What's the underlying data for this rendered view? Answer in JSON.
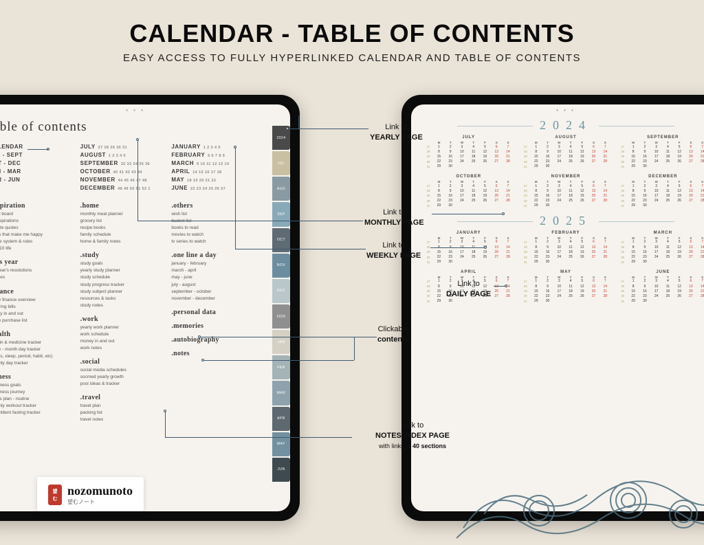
{
  "header": {
    "title": "CALENDAR - TABLE OF CONTENTS",
    "subtitle": "EASY ACCESS TO FULLY HYPERLINKED CALENDAR AND TABLE OF CONTENTS"
  },
  "toc": {
    "title": "table of contents",
    "topcols": [
      {
        "items": [
          "CALENDAR",
          "JUL - SEPT",
          "OCT - DEC",
          "JAN - MAR",
          "APR - JUN"
        ]
      },
      {
        "items": [
          "JULY",
          "AUGUST",
          "SEPTEMBER",
          "OCTOBER",
          "NOVEMBER",
          "DECEMBER"
        ],
        "nums": [
          "27 28 29 30 31",
          "1 2 3 4 5",
          "32 33 34 35 36",
          "40 41 42 43 44",
          "44 45 46 47 48",
          "48 49 50 51 52 1"
        ]
      },
      {
        "items": [
          "JANUARY",
          "FEBRUARY",
          "MARCH",
          "APRIL",
          "MAY",
          "JUNE"
        ],
        "nums": [
          "1 2 3 4 5",
          "5 6 7 8 9",
          "9 10 11 12 13 14",
          "14 15 16 17 18",
          "18 19 20 21 22",
          "22 23 24 25 26 27"
        ]
      }
    ],
    "sections": [
      {
        "head": ".inspiration",
        "items": [
          "visual board",
          "life inspirations",
          "favorite quotes",
          "things that make me happy",
          "my life system & rules",
          "level 10 life"
        ]
      },
      {
        "head": ".this year",
        "items": [
          "this year's resolutions",
          "routines"
        ]
      },
      {
        "head": ".finance",
        "items": [
          "yearly finance overview",
          "recurring bills",
          "money in and out",
          "online purchase list"
        ]
      },
      {
        "head": ".health",
        "items": [
          "vitamin & medicine tracker",
          "yearly - month day tracker",
          "(drinks, sleep, period, habit, etc)",
          "monthly day tracker"
        ]
      },
      {
        "head": ".fitness",
        "items": [
          "my fitness goals",
          "my fitness journey",
          "fitness plan - routine",
          "monthly workout tracker",
          "intermittent fasting tracker"
        ]
      }
    ],
    "sections2": [
      {
        "head": ".home",
        "items": [
          "monthly meal planner",
          "grocery list",
          "recipe books",
          "family schedule",
          "home & family notes"
        ]
      },
      {
        "head": ".study",
        "items": [
          "study goals",
          "yearly study planner",
          "study schedule",
          "study progress tracker",
          "study subject planner",
          "resources & tasks",
          "study notes"
        ]
      },
      {
        "head": ".work",
        "items": [
          "yearly work planner",
          "work schedule",
          "money in and out",
          "work notes"
        ]
      },
      {
        "head": ".social",
        "items": [
          "social media schedules",
          "socmed yearly growth",
          "post ideas & tracker"
        ]
      },
      {
        "head": ".travel",
        "items": [
          "travel plan",
          "packing list",
          "travel notes"
        ]
      }
    ],
    "sections3": [
      {
        "head": ".others",
        "items": [
          "wish list",
          "bucket list",
          "books to read",
          "movies to watch",
          "tv series to watch"
        ]
      },
      {
        "head": ".one line a day",
        "items": [
          "january - february",
          "march - april",
          "may - june",
          "july - august",
          "september - october",
          "november - december"
        ]
      },
      {
        "head": ".personal data",
        "items": []
      },
      {
        "head": ".memories",
        "items": []
      },
      {
        "head": ".autobiography",
        "items": []
      },
      {
        "head": ".notes",
        "items": []
      }
    ],
    "tabs": [
      {
        "label": "2024",
        "color": "#4a4a4a"
      },
      {
        "label": "JUL",
        "color": "#c9bfa3"
      },
      {
        "label": "AUG",
        "color": "#8a9aa3"
      },
      {
        "label": "SEP",
        "color": "#88a9b8"
      },
      {
        "label": "OCT",
        "color": "#5f6b74"
      },
      {
        "label": "NOV",
        "color": "#6c8da0"
      },
      {
        "label": "DEC",
        "color": "#b9c6ca"
      },
      {
        "label": "2025",
        "color": "#8f8f8f"
      },
      {
        "label": "JAN",
        "color": "#d5d0c4"
      },
      {
        "label": "FEB",
        "color": "#a3b3b6"
      },
      {
        "label": "MAR",
        "color": "#8ea2ad"
      },
      {
        "label": "APR",
        "color": "#5d6870"
      },
      {
        "label": "MAY",
        "color": "#7290a0"
      },
      {
        "label": "JUN",
        "color": "#3e4a4f"
      }
    ]
  },
  "callouts": {
    "yearly": {
      "line1": "Link to",
      "line2": "YEARLY PAGE"
    },
    "monthly": {
      "line1": "Link to",
      "line2": "MONTHLY PAGE"
    },
    "weekly": {
      "line1": "Link to",
      "line2": "WEEKLY PAGE"
    },
    "daily": {
      "line1": "Link to",
      "line2": "DAILY PAGE"
    },
    "contents": {
      "line1": "Clickable",
      "line2": "contents"
    },
    "notes": {
      "line1": "Link to",
      "line2": "NOTES INDEX PAGE",
      "line3a": "with links to ",
      "line3b": "40 sections"
    }
  },
  "calendar": {
    "year1": "2024",
    "year2": "2025",
    "months1": [
      "JULY",
      "AUGUST",
      "SEPTEMBER",
      "OCTOBER",
      "NOVEMBER",
      "DECEMBER"
    ],
    "months2": [
      "JANUARY",
      "FEBRUARY",
      "MARCH",
      "APRIL",
      "MAY",
      "JUNE"
    ]
  },
  "brand": {
    "name": "nozomunoto",
    "sub": "望むノート"
  }
}
